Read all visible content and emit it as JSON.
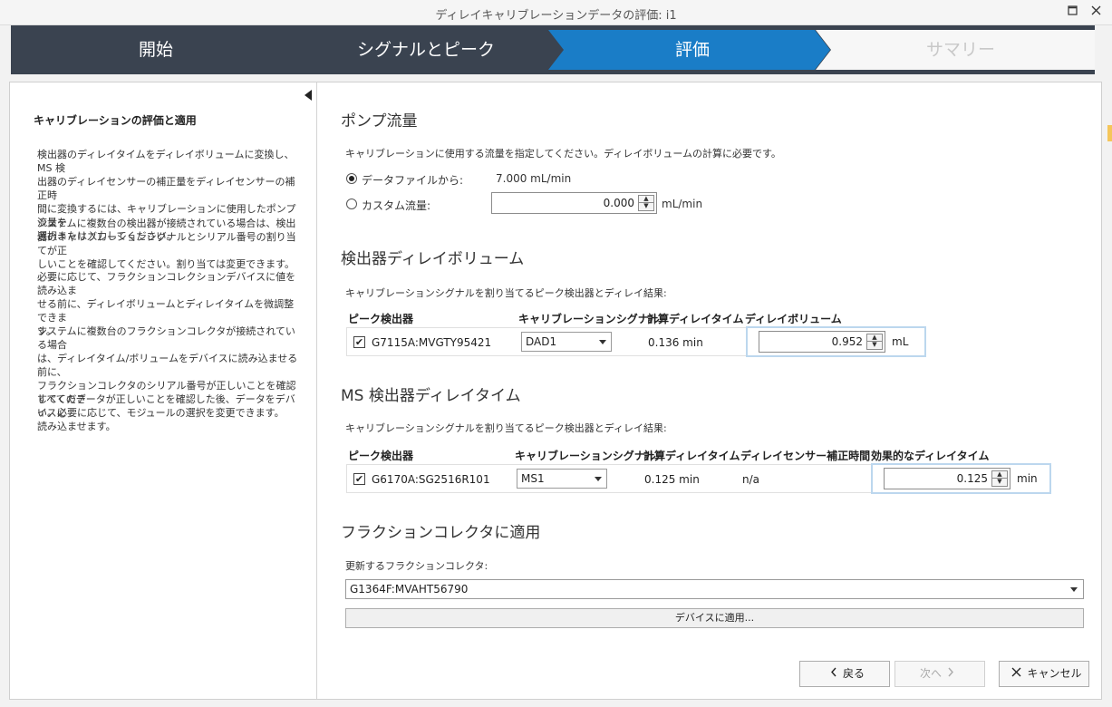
{
  "window": {
    "title": "ディレイキャリブレーションデータの評価: i1",
    "maximize_icon": "maximize-icon",
    "close_icon": "close-icon"
  },
  "steps": [
    {
      "label": "開始",
      "state": "done"
    },
    {
      "label": "シグナルとピーク",
      "state": "done"
    },
    {
      "label": "評価",
      "state": "active"
    },
    {
      "label": "サマリー",
      "state": "pending"
    }
  ],
  "colors": {
    "stepper_bg": "#3a4350",
    "active_step": "#1a7dc7",
    "pending_step": "#f7f7f7",
    "highlight": "#bcd7ee"
  },
  "left_panel": {
    "title": "キャリブレーションの評価と適用",
    "paragraphs": [
      [
        "検出器のディレイタイムをディレイボリュームに変換し、MS 検",
        "出器のディレイセンサーの補正量をディレイセンサーの補正時",
        "間に変換するには、キャリブレーションに使用したポンプ流量を",
        "選択または入力してください。"
      ],
      [
        "システムに複数台の検出器が接続されている場合は、検出",
        "器のキャリブレーションシグナルとシリアル番号の割り当てが正",
        "しいことを確認してください。割り当ては変更できます。"
      ],
      [
        "必要に応じて、フラクションコレクションデバイスに値を読み込ま",
        "せる前に、ディレイボリュームとディレイタイムを微調整できま",
        "す。"
      ],
      [
        "システムに複数台のフラクションコレクタが接続されている場合",
        "は、ディレイタイム/ボリュームをデバイスに読み込ませる前に、",
        "フラクションコレクタのシリアル番号が正しいことを確認してくださ",
        "い。必要に応じて、モジュールの選択を変更できます。"
      ],
      [
        "すべてのデータが正しいことを確認した後、データをデバイスに",
        "読み込ませます。"
      ]
    ]
  },
  "pump_flow": {
    "title": "ポンプ流量",
    "hint": "キャリブレーションに使用する流量を指定してください。ディレイボリュームの計算に必要です。",
    "from_file_label": "データファイルから:",
    "from_file_value": "7.000 mL/min",
    "custom_label": "カスタム流量:",
    "custom_value": "0.000",
    "custom_unit": "mL/min",
    "selected": "from_file"
  },
  "detector_delay": {
    "title": "検出器ディレイボリューム",
    "hint": "キャリブレーションシグナルを割り当てるピーク検出器とディレイ結果:",
    "headers": {
      "detector": "ピーク検出器",
      "signal": "キャリブレーションシグナル",
      "calc_time": "計算ディレイタイム",
      "volume": "ディレイボリューム"
    },
    "row": {
      "checked": true,
      "detector": "G7115A:MVGTY95421",
      "signal": "DAD1",
      "calc_time": "0.136 min",
      "volume": "0.952",
      "volume_unit": "mL"
    }
  },
  "ms_delay": {
    "title": "MS 検出器ディレイタイム",
    "hint": "キャリブレーションシグナルを割り当てるピーク検出器とディレイ結果:",
    "headers": {
      "detector": "ピーク検出器",
      "signal": "キャリブレーションシグナル",
      "calc_time": "計算ディレイタイム",
      "sensor_time": "ディレイセンサー補正時間",
      "effective": "効果的なディレイタイム"
    },
    "row": {
      "checked": true,
      "detector": "G6170A:SG2516R101",
      "signal": "MS1",
      "calc_time": "0.125 min",
      "sensor_time": "n/a",
      "effective": "0.125",
      "effective_unit": "min"
    }
  },
  "fraction": {
    "title": "フラクションコレクタに適用",
    "label": "更新するフラクションコレクタ:",
    "selected": "G1364F:MVAHT56790",
    "apply_button": "デバイスに適用..."
  },
  "nav": {
    "back": "戻る",
    "next": "次へ",
    "cancel": "キャンセル"
  }
}
